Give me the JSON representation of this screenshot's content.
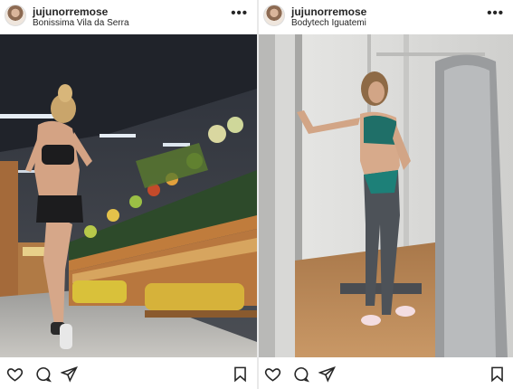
{
  "posts": [
    {
      "username": "jujunorremose",
      "location": "Bonissima Vila da Serra",
      "more_icon": "ellipsis-icon",
      "photo_subject": "supermarket"
    },
    {
      "username": "jujunorremose",
      "location": "Bodytech Iguatemi",
      "more_icon": "ellipsis-icon",
      "photo_subject": "gym"
    }
  ],
  "actions": [
    "heart-icon",
    "comment-icon",
    "share-icon",
    "bookmark-icon"
  ],
  "colors": {
    "text": "#262626",
    "divider": "#e9e9e9",
    "background": "#ffffff"
  }
}
